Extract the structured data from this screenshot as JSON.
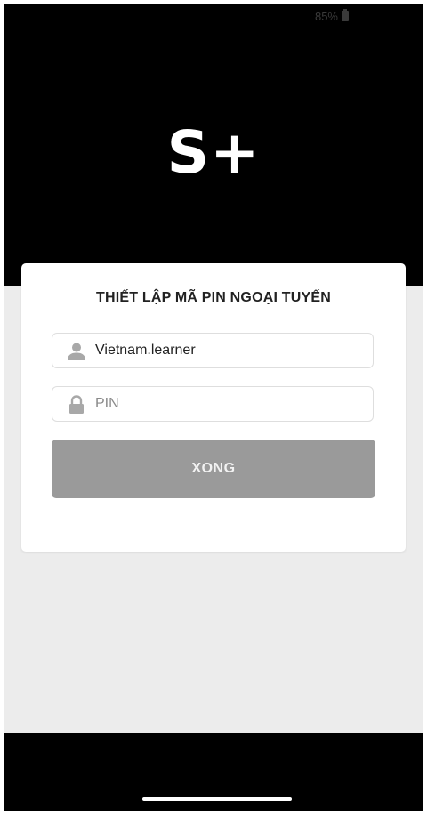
{
  "status_bar": {
    "battery": "85%"
  },
  "app": {
    "logo": "S+"
  },
  "form": {
    "title": "THIẾT LẬP MÃ PIN NGOẠI TUYẾN",
    "username": {
      "value": "Vietnam.learner",
      "icon": "user-icon"
    },
    "pin": {
      "value": "",
      "placeholder": "PIN",
      "icon": "lock-icon"
    },
    "submit_label": "XONG"
  },
  "colors": {
    "background": "#ececec",
    "panel": "#000000",
    "button": "#9a9a9a",
    "icon": "#a8a8a8"
  }
}
